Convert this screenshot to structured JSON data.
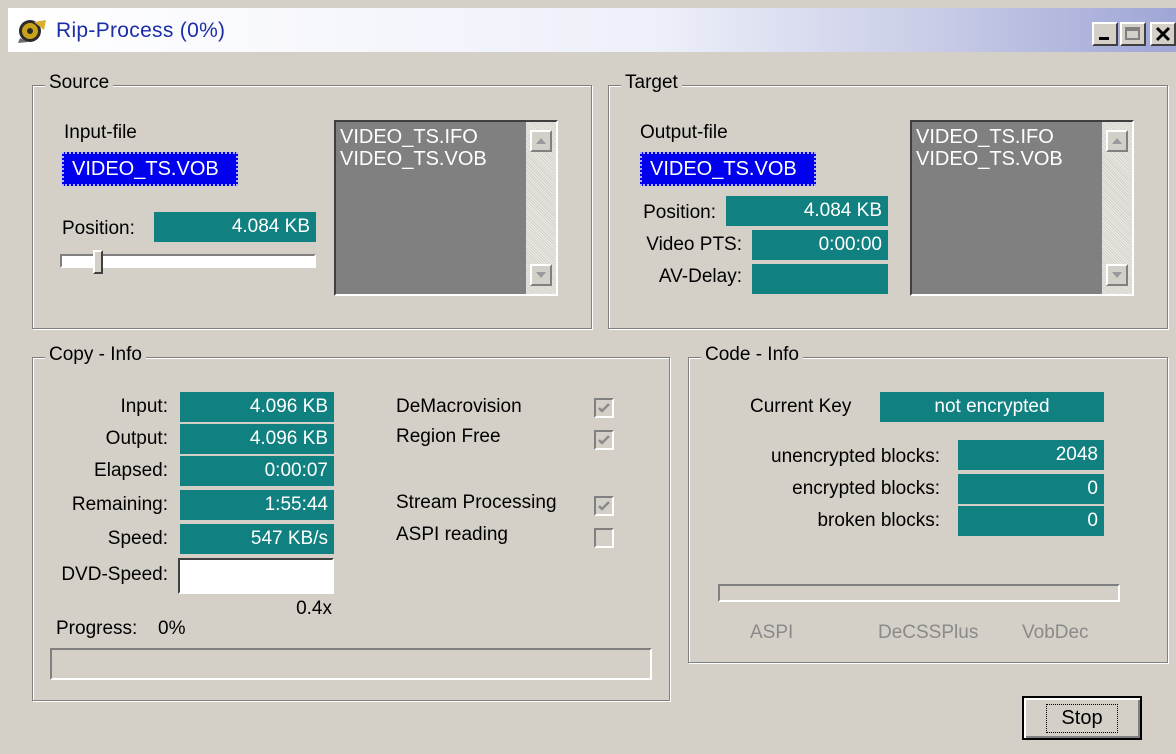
{
  "window": {
    "title": "Rip-Process (0%)"
  },
  "source": {
    "legend": "Source",
    "input_file_label": "Input-file",
    "input_file_value": "VIDEO_TS.VOB",
    "position_label": "Position:",
    "position_value": "4.084 KB",
    "position_slider_fraction": 0.13,
    "files": [
      "VIDEO_TS.IFO",
      "VIDEO_TS.VOB"
    ]
  },
  "target": {
    "legend": "Target",
    "output_file_label": "Output-file",
    "output_file_value": "VIDEO_TS.VOB",
    "position_label": "Position:",
    "position_value": "4.084 KB",
    "video_pts_label": "Video PTS:",
    "video_pts_value": "0:00:00",
    "av_delay_label": "AV-Delay:",
    "av_delay_value": "",
    "files": [
      "VIDEO_TS.IFO",
      "VIDEO_TS.VOB"
    ]
  },
  "copy_info": {
    "legend": "Copy - Info",
    "rows": [
      {
        "label": "Input:",
        "value": "4.096 KB"
      },
      {
        "label": "Output:",
        "value": "4.096 KB"
      },
      {
        "label": "Elapsed:",
        "value": "0:00:07"
      },
      {
        "label": "Remaining:",
        "value": "1:55:44"
      },
      {
        "label": "Speed:",
        "value": "547 KB/s"
      }
    ],
    "dvd_speed_label": "DVD-Speed:",
    "dvd_speed_value": "0.4x",
    "progress_label": "Progress:",
    "progress_value": "0%",
    "progress_fraction": 0.0,
    "options": [
      {
        "label": "DeMacrovision",
        "checked": true,
        "disabled": true
      },
      {
        "label": "Region Free",
        "checked": true,
        "disabled": true
      },
      {
        "label": "Stream Processing",
        "checked": true,
        "disabled": true
      },
      {
        "label": "ASPI reading",
        "checked": false,
        "disabled": true
      }
    ]
  },
  "code_info": {
    "legend": "Code - Info",
    "current_key_label": "Current Key",
    "current_key_value": "not encrypted",
    "unencrypted_label": "unencrypted blocks:",
    "unencrypted_value": "2048",
    "encrypted_label": "encrypted blocks:",
    "encrypted_value": "0",
    "broken_label": "broken blocks:",
    "broken_value": "0",
    "methods": [
      "ASPI",
      "DeCSSPlus",
      "VobDec"
    ]
  },
  "buttons": {
    "stop": "Stop"
  },
  "colors": {
    "field_bg": "#118080",
    "selection_bg": "#0000ee",
    "face": "#d4d0c8"
  }
}
